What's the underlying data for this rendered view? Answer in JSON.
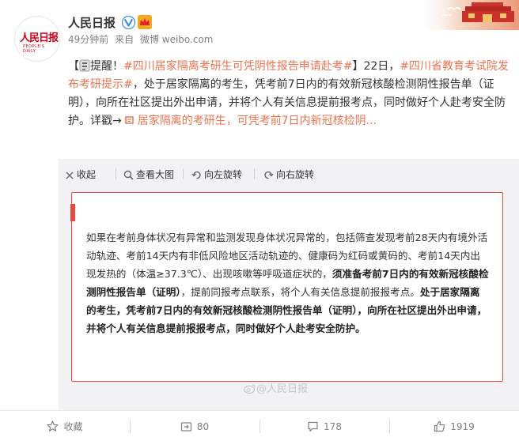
{
  "header": {
    "author": "人民日报",
    "logo_text": "人民日报",
    "logo_sub": "PEOPLE'S DAILY",
    "time": "49分钟前",
    "source_prefix": "来自",
    "source": "微博 weibo.com"
  },
  "post": {
    "bracket_open": "【",
    "title_link": "提醒！",
    "hashtag1": "#四川居家隔离考研生可凭阴性报告申请赴考#",
    "text1": "】22日，",
    "hashtag2": "#四川省教育考试院发布考研提示#",
    "text2": "，处于居家隔离的考生，凭考前7日内的有效新冠核酸检测阴性报告单（证明），向所在社区提出外出申请，并将个人有关信息提前报考点，同时做好个人赴考安全防护。详戳→",
    "link_text": "居家隔离的考研生，可凭考前7日内新冠核检阴..."
  },
  "toolbar": {
    "collapse": "收起",
    "view_large": "查看大图",
    "rotate_left": "向左旋转",
    "rotate_right": "向右旋转"
  },
  "notice": {
    "p1": "如果在考前身体状况有异常和监测发现身体状况异常的，包括筛查发现考前28天内有境外活动轨迹、考前14天内有非低风险地区活动轨迹的、健康码为红码或黄码的、考前14天内出现发热的（体温≥37.3℃）、出现咳嗽等呼吸道症状的，",
    "b1": "须准备考前7日内的有效新冠核酸检测阴性报告单（证明）",
    "p2": "，提前同报考点联系，将个人有关信息提前报报考点。",
    "b2": "处于居家隔离的考生，凭考前7日内的有效新冠核酸检测阴性报告单（证明），向所在社区提出外出申请，并将个人有关信息提前报报考点，同时做好个人赴考安全防护。",
    "watermark": "@人民日报"
  },
  "actions": {
    "favorite": "收藏",
    "repost_count": "80",
    "comment_count": "178",
    "like_count": "1919"
  },
  "colors": {
    "link": "#eb7350",
    "accent_red": "#e64a3c",
    "muted": "#808080"
  }
}
